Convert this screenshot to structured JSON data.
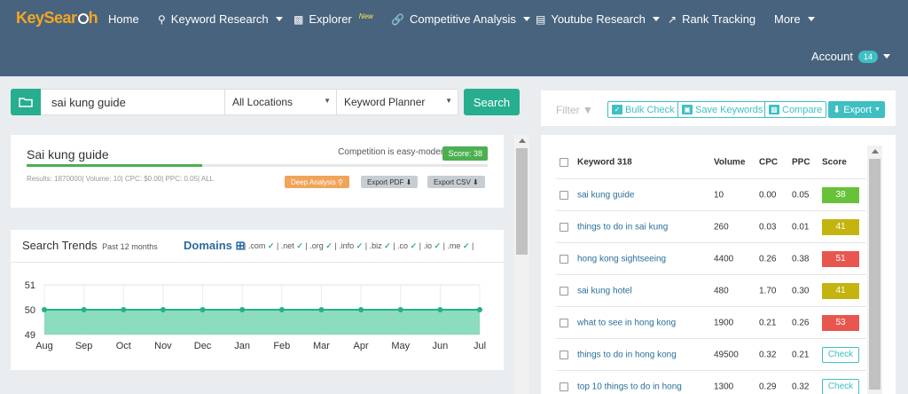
{
  "nav": {
    "logo_main": "KeySear",
    "logo_end": "h",
    "items": [
      {
        "label": "Home",
        "icon": ""
      },
      {
        "label": "Keyword Research",
        "icon": "search-icon",
        "caret": true
      },
      {
        "label": "Explorer",
        "icon": "bar-chart-icon",
        "badge": "New"
      },
      {
        "label": "Competitive Analysis",
        "icon": "link-icon",
        "caret": true
      },
      {
        "label": "Youtube Research",
        "icon": "video-icon",
        "caret": true
      },
      {
        "label": "Rank Tracking",
        "icon": "line-chart-icon"
      },
      {
        "label": "More",
        "caret": true
      }
    ],
    "account_label": "Account",
    "account_count": "14"
  },
  "search": {
    "keyword": "sai kung guide",
    "location": "All Locations",
    "source": "Keyword Planner",
    "button": "Search"
  },
  "summary": {
    "title": "Sai kung guide",
    "competition": "Competition is easy-moderate",
    "score": "Score: 38",
    "progress": 0.38,
    "meta": "Results: 1870000| Volume: 10| CPC: $0.00| PPC: 0.05| ALL",
    "deep_analysis": "Deep Analysis",
    "export_pdf": "Export PDF",
    "export_csv": "Export CSV"
  },
  "trends": {
    "title": "Search Trends",
    "subtitle": "Past 12 months",
    "domains_label": "Domains",
    "domains": [
      ".com",
      ".net",
      ".org",
      ".info",
      ".biz",
      ".co",
      ".io",
      ".me"
    ]
  },
  "chart_data": {
    "type": "area",
    "x": [
      "Aug",
      "Sep",
      "Oct",
      "Nov",
      "Dec",
      "Jan",
      "Feb",
      "Mar",
      "Apr",
      "May",
      "Jun",
      "Jul"
    ],
    "values": [
      50,
      50,
      50,
      50,
      50,
      50,
      50,
      50,
      50,
      50,
      50,
      50
    ],
    "ylim": [
      49,
      51
    ],
    "yticks": [
      49,
      50,
      51
    ],
    "grid": true,
    "colors": {
      "fill": "#7fd8b8",
      "line": "#27ae8f"
    }
  },
  "toolbar": {
    "filter": "Filter",
    "bulk_check": "Bulk Check",
    "save_keywords": "Save Keywords",
    "compare": "Compare",
    "export": "Export"
  },
  "table": {
    "headers": {
      "keyword": "Keyword 318",
      "volume": "Volume",
      "cpc": "CPC",
      "ppc": "PPC",
      "score": "Score"
    },
    "rows": [
      {
        "keyword": "sai kung guide",
        "volume": "10",
        "cpc": "0.00",
        "ppc": "0.05",
        "score": "38",
        "color": "#67c23a"
      },
      {
        "keyword": "things to do in sai kung",
        "volume": "260",
        "cpc": "0.03",
        "ppc": "0.01",
        "score": "41",
        "color": "#c4b410"
      },
      {
        "keyword": "hong kong sightseeing",
        "volume": "4400",
        "cpc": "0.26",
        "ppc": "0.38",
        "score": "51",
        "color": "#e8574f"
      },
      {
        "keyword": "sai kung hotel",
        "volume": "480",
        "cpc": "1.70",
        "ppc": "0.30",
        "score": "41",
        "color": "#c4b410"
      },
      {
        "keyword": "what to see in hong kong",
        "volume": "1900",
        "cpc": "0.21",
        "ppc": "0.26",
        "score": "53",
        "color": "#e8574f"
      },
      {
        "keyword": "things to do in hong kong",
        "volume": "49500",
        "cpc": "0.32",
        "ppc": "0.21",
        "score": "Check",
        "color": ""
      },
      {
        "keyword": "top 10 things to do in hong",
        "volume": "1300",
        "cpc": "0.29",
        "ppc": "0.32",
        "score": "Check",
        "color": ""
      }
    ]
  }
}
